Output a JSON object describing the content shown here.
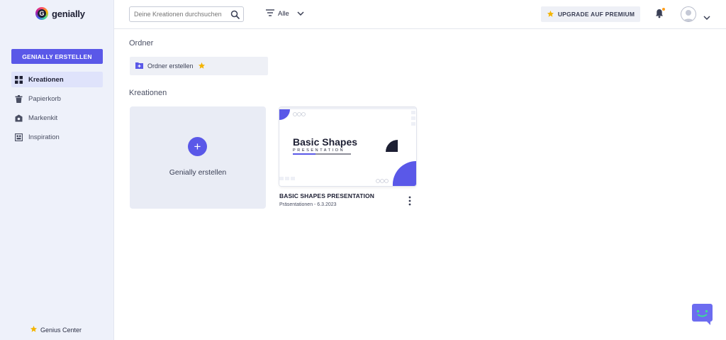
{
  "app": {
    "name": "genially"
  },
  "sidebar": {
    "create_button": "GENIALLY ERSTELLEN",
    "items": [
      {
        "label": "Kreationen",
        "icon": "grid-icon",
        "active": true
      },
      {
        "label": "Papierkorb",
        "icon": "trash-icon",
        "active": false
      },
      {
        "label": "Markenkit",
        "icon": "brand-kit-icon",
        "active": false
      },
      {
        "label": "Inspiration",
        "icon": "inspiration-icon",
        "active": false
      }
    ],
    "genius_center": "Genius Center"
  },
  "topbar": {
    "search_placeholder": "Deine Kreationen durchsuchen",
    "filter_label": "Alle",
    "upgrade_label": "UPGRADE AUF PREMIUM"
  },
  "main": {
    "folders_title": "Ordner",
    "create_folder_label": "Ordner erstellen",
    "creations_title": "Kreationen",
    "create_card_label": "Genially erstellen",
    "cards": [
      {
        "title": "BASIC SHAPES PRESENTATION",
        "meta": "Präsentationen - 6.3.2023",
        "thumb_title": "Basic Shapes",
        "thumb_subtitle": "PRESENTATION"
      }
    ]
  },
  "colors": {
    "accent": "#5a58e8",
    "sidebar_bg": "#eef1fa",
    "star": "#f4b400",
    "chat_bubble": "#6c6cf0",
    "chat_face": "#3ddc97"
  }
}
